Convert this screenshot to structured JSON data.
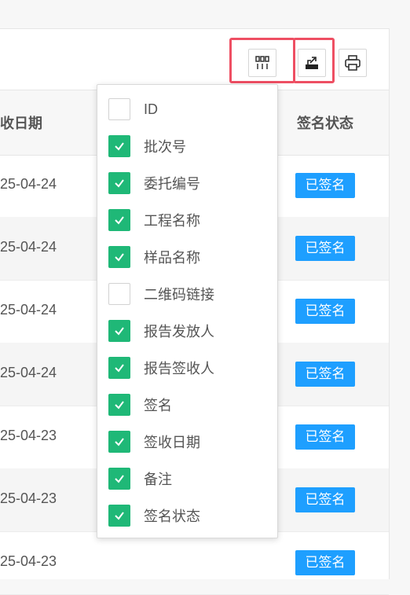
{
  "columns": {
    "sign_date_partial": "收日期",
    "sign_status": "签名状态"
  },
  "rows": [
    {
      "date": "25-04-24",
      "status": "已签名"
    },
    {
      "date": "25-04-24",
      "status": "已签名"
    },
    {
      "date": "25-04-24",
      "status": "已签名"
    },
    {
      "date": "25-04-24",
      "status": "已签名"
    },
    {
      "date": "25-04-23",
      "status": "已签名"
    },
    {
      "date": "25-04-23",
      "status": "已签名"
    },
    {
      "date": "25-04-23",
      "status": "已签名"
    }
  ],
  "toolbar": {
    "columns_icon": "columns-icon",
    "export_icon": "export-icon",
    "print_icon": "print-icon"
  },
  "column_menu": [
    {
      "label": "ID",
      "checked": false
    },
    {
      "label": "批次号",
      "checked": true
    },
    {
      "label": "委托编号",
      "checked": true
    },
    {
      "label": "工程名称",
      "checked": true
    },
    {
      "label": "样品名称",
      "checked": true
    },
    {
      "label": "二维码链接",
      "checked": false
    },
    {
      "label": "报告发放人",
      "checked": true
    },
    {
      "label": "报告签收人",
      "checked": true
    },
    {
      "label": "签名",
      "checked": true
    },
    {
      "label": "签收日期",
      "checked": true
    },
    {
      "label": "备注",
      "checked": true
    },
    {
      "label": "签名状态",
      "checked": true
    }
  ],
  "colors": {
    "accent_green": "#1fb877",
    "badge_blue": "#1e9fff",
    "highlight_red": "#ee4f63"
  }
}
